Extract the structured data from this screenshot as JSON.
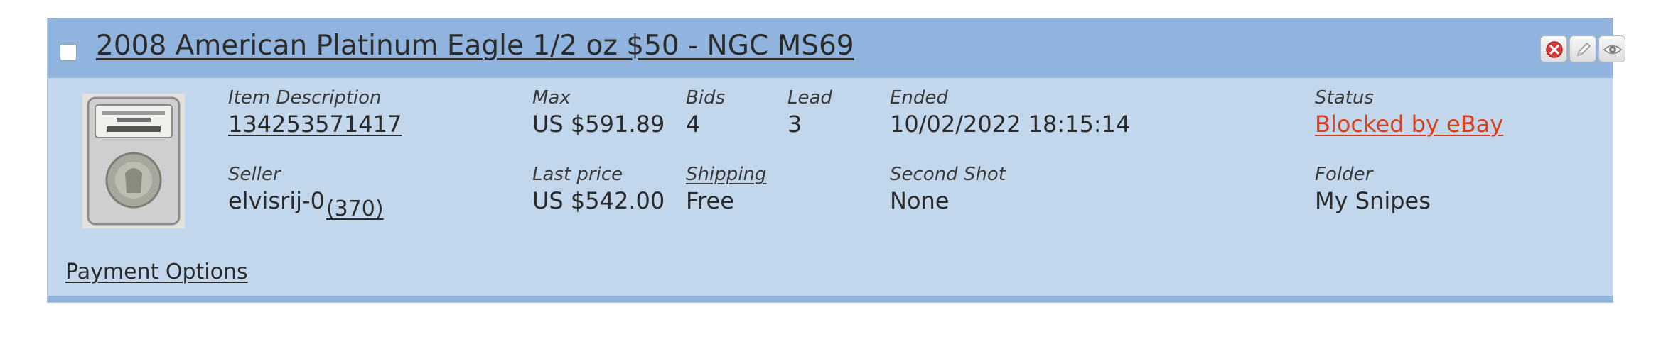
{
  "item": {
    "title": "2008 American Platinum Eagle 1/2 oz $50 - NGC MS69",
    "item_description_label": "Item Description",
    "item_number": "134253571417",
    "max_label": "Max",
    "max_value": "US $591.89",
    "bids_label": "Bids",
    "bids_value": "4",
    "lead_label": "Lead",
    "lead_value": "3",
    "ended_label": "Ended",
    "ended_value": "10/02/2022 18:15:14",
    "status_label": "Status",
    "status_value": "Blocked by eBay",
    "seller_label": "Seller",
    "seller_name": "elvisrij-0",
    "seller_feedback": "(370)",
    "last_price_label": "Last price",
    "last_price_value": "US $542.00",
    "shipping_label": "Shipping",
    "shipping_value": "Free",
    "second_shot_label": "Second Shot",
    "second_shot_value": "None",
    "folder_label": "Folder",
    "folder_value": "My Snipes",
    "payment_options_link": "Payment Options"
  },
  "icons": [
    "delete-icon",
    "edit-pencil-icon",
    "watch-eye-icon",
    "coin-slab-thumbnail"
  ],
  "colors": {
    "header_bg": "#90b4dd",
    "body_bg": "#c2d7ec",
    "status_red": "#d9401e"
  }
}
